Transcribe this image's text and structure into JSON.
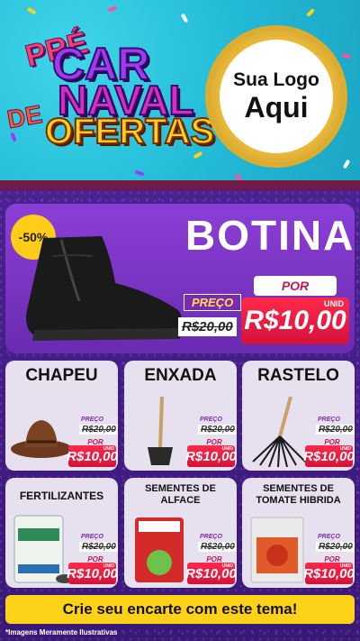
{
  "header": {
    "title_pre": "PRÉ",
    "title_car": "CAR",
    "title_naval": "NAVAL",
    "title_de": "DE",
    "title_ofertas": "OFERTAS",
    "logo_line1": "Sua Logo",
    "logo_line2": "Aqui"
  },
  "featured": {
    "discount_badge": "-50%",
    "name": "BOTINA",
    "old_label": "PREÇO",
    "old_price": "R$20,00",
    "new_label": "POR",
    "new_price": "R$10,00",
    "unit": "UNID"
  },
  "products": [
    {
      "name": "CHAPEU",
      "old_label": "PREÇO",
      "old_price": "R$20,00",
      "new_label": "POR",
      "new_price": "R$10,00",
      "unit": "UNID"
    },
    {
      "name": "ENXADA",
      "old_label": "PREÇO",
      "old_price": "R$20,00",
      "new_label": "POR",
      "new_price": "R$10,00",
      "unit": "UNID"
    },
    {
      "name": "RASTELO",
      "old_label": "PREÇO",
      "old_price": "R$20,00",
      "new_label": "POR",
      "new_price": "R$10,00",
      "unit": "UNID"
    },
    {
      "name": "FERTILIZANTES",
      "old_label": "PREÇO",
      "old_price": "R$20,00",
      "new_label": "POR",
      "new_price": "R$10,00",
      "unit": "UNID"
    },
    {
      "name": "SEMENTES DE ALFACE",
      "old_label": "PREÇO",
      "old_price": "R$20,00",
      "new_label": "POR",
      "new_price": "R$10,00",
      "unit": "UNID"
    },
    {
      "name": "SEMENTES DE TOMATE HIBRIDA",
      "old_label": "PREÇO",
      "old_price": "R$20,00",
      "new_label": "POR",
      "new_price": "R$10,00",
      "unit": "UNID"
    }
  ],
  "footer": {
    "cta": "Crie seu encarte com este tema!",
    "disclaimer": "*Imagens Meramente Ilustrativas"
  },
  "colors": {
    "accent": "#ffd21a",
    "price_red": "#e0183f",
    "purple": "#6a2ab0",
    "cyan": "#22b9d6"
  }
}
